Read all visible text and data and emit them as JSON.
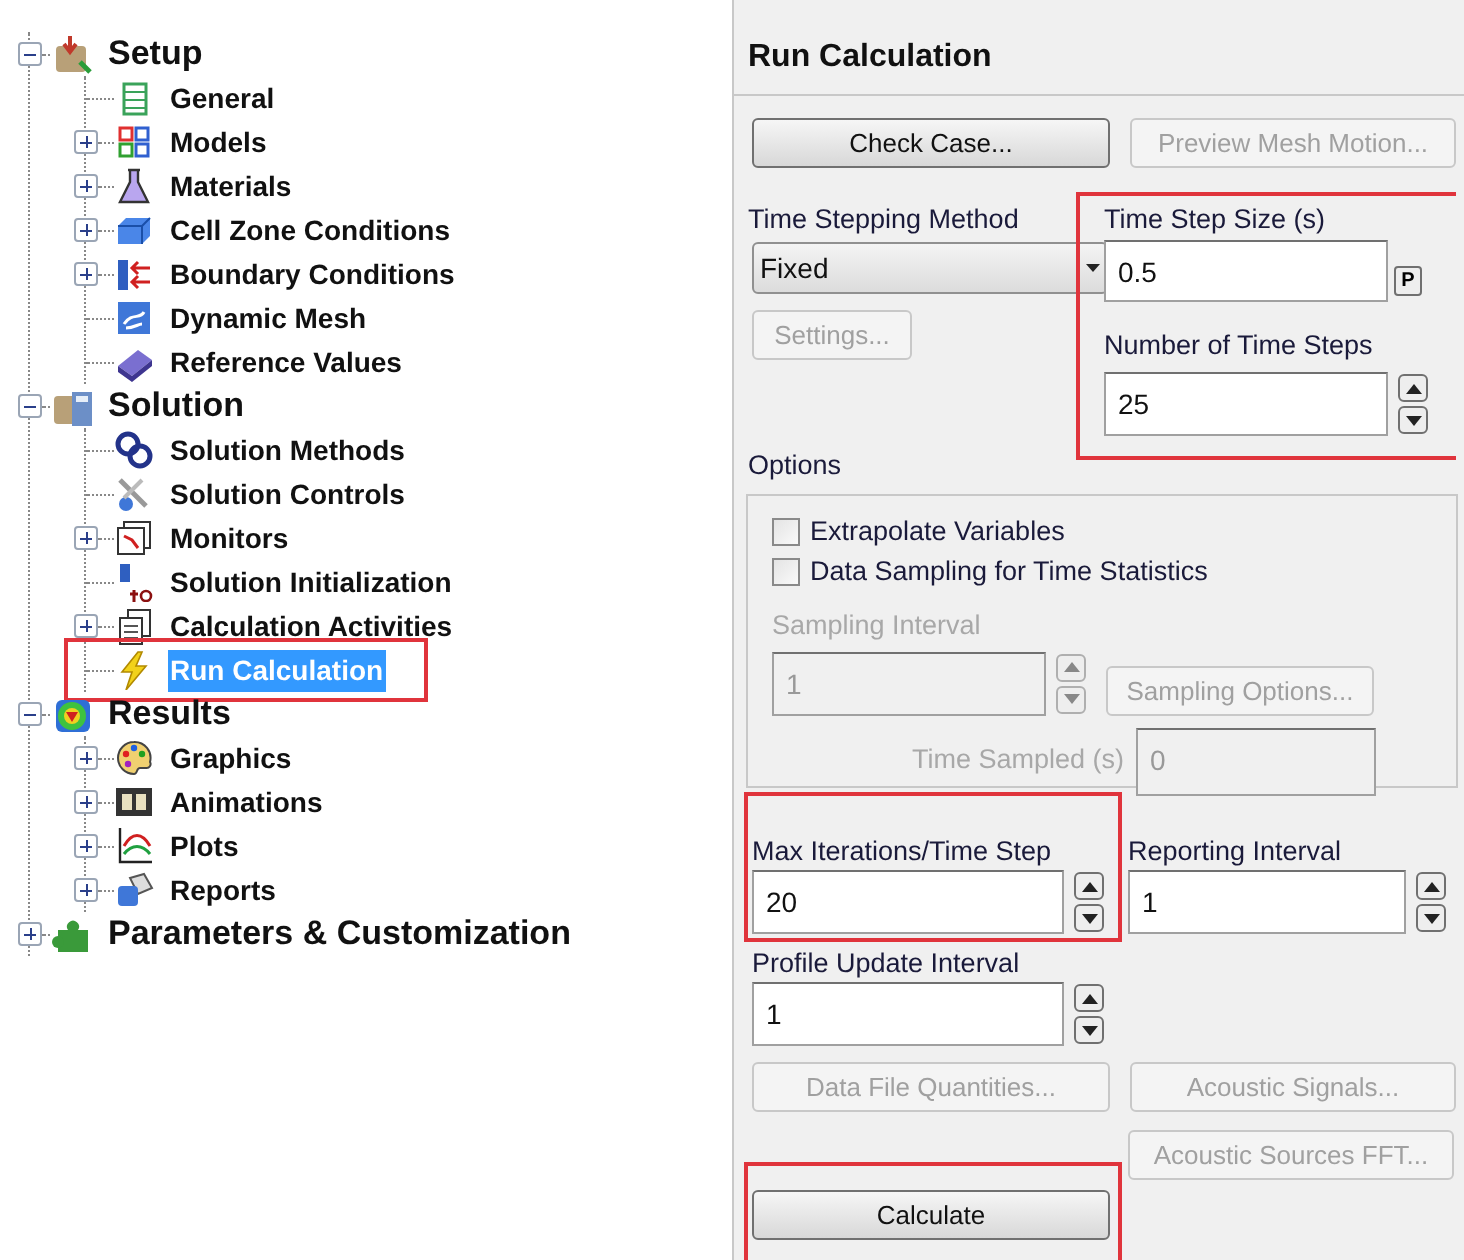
{
  "tree": [
    {
      "label": "Setup",
      "expanded": true,
      "selected": false,
      "children": [
        {
          "label": "General",
          "expandable": false,
          "selected": false
        },
        {
          "label": "Models",
          "expandable": true,
          "expanded": false,
          "selected": false
        },
        {
          "label": "Materials",
          "expandable": true,
          "expanded": false,
          "selected": false
        },
        {
          "label": "Cell Zone Conditions",
          "expandable": true,
          "expanded": false,
          "selected": false
        },
        {
          "label": "Boundary Conditions",
          "expandable": true,
          "expanded": false,
          "selected": false
        },
        {
          "label": "Dynamic Mesh",
          "expandable": false,
          "selected": false
        },
        {
          "label": "Reference Values",
          "expandable": false,
          "selected": false
        }
      ]
    },
    {
      "label": "Solution",
      "expanded": true,
      "selected": false,
      "children": [
        {
          "label": "Solution Methods",
          "expandable": false,
          "selected": false
        },
        {
          "label": "Solution Controls",
          "expandable": false,
          "selected": false
        },
        {
          "label": "Monitors",
          "expandable": true,
          "expanded": false,
          "selected": false
        },
        {
          "label": "Solution Initialization",
          "expandable": false,
          "selected": false
        },
        {
          "label": "Calculation Activities",
          "expandable": true,
          "expanded": false,
          "selected": false
        },
        {
          "label": "Run Calculation",
          "expandable": false,
          "selected": true,
          "annotated": true
        }
      ]
    },
    {
      "label": "Results",
      "expanded": true,
      "selected": false,
      "children": [
        {
          "label": "Graphics",
          "expandable": true,
          "expanded": false,
          "selected": false
        },
        {
          "label": "Animations",
          "expandable": true,
          "expanded": false,
          "selected": false
        },
        {
          "label": "Plots",
          "expandable": true,
          "expanded": false,
          "selected": false
        },
        {
          "label": "Reports",
          "expandable": true,
          "expanded": false,
          "selected": false
        }
      ]
    },
    {
      "label": "Parameters & Customization",
      "expanded": false,
      "selected": false
    }
  ],
  "panel": {
    "title": "Run Calculation",
    "top_buttons": [
      {
        "label": "Check Case...",
        "disabled": false
      },
      {
        "label": "Preview Mesh Motion...",
        "disabled": true
      }
    ],
    "time_stepping_method": {
      "label": "Time Stepping Method",
      "value": "Fixed"
    },
    "settings_button": {
      "label": "Settings...",
      "disabled": true
    },
    "time_step_group": {
      "annotated": true,
      "time_step_size": {
        "label": "Time Step Size (s)",
        "value": "0.5",
        "param_button": "P"
      },
      "number_of_time_steps": {
        "label": "Number of Time Steps",
        "value": "25"
      }
    },
    "options": {
      "label": "Options",
      "checkboxes": [
        {
          "label": "Extrapolate Variables",
          "checked": false
        },
        {
          "label": "Data Sampling for Time Statistics",
          "checked": false
        }
      ],
      "sampling_interval": {
        "label": "Sampling Interval",
        "value": "1",
        "disabled": true
      },
      "sampling_options_button": {
        "label": "Sampling Options...",
        "disabled": true
      },
      "time_sampled": {
        "label": "Time Sampled (s)",
        "value": "0",
        "disabled": true
      }
    },
    "max_iterations": {
      "label": "Max Iterations/Time Step",
      "value": "20",
      "annotated": true
    },
    "reporting_interval": {
      "label": "Reporting Interval",
      "value": "1",
      "annotated": false
    },
    "profile_update_interval": {
      "label": "Profile Update Interval",
      "value": "1",
      "annotated": false
    },
    "bottom_buttons": [
      {
        "label": "Data File Quantities...",
        "disabled": true
      },
      {
        "label": "Acoustic Signals...",
        "disabled": true
      },
      {
        "label": "Acoustic Sources FFT...",
        "disabled": true
      }
    ],
    "calculate_button": {
      "label": "Calculate",
      "disabled": false,
      "annotated": true
    }
  }
}
